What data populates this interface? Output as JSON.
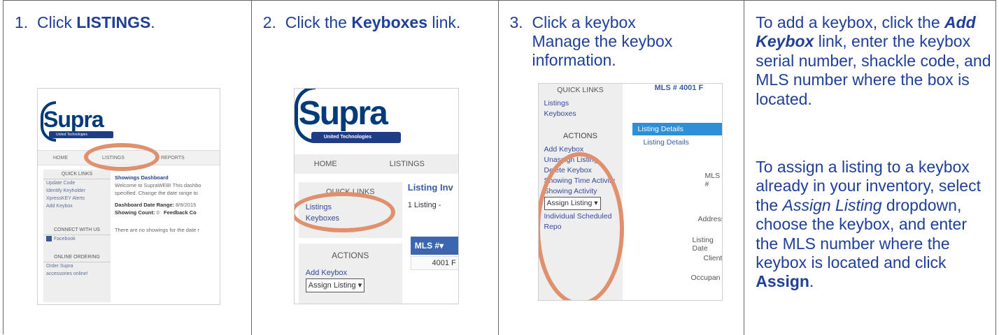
{
  "col1": {
    "num": "1.",
    "text_pre": "Click ",
    "bold": "LISTINGS",
    "text_post": "."
  },
  "col2": {
    "num": "2.",
    "text_pre": "Click the ",
    "bold": "Keyboxes",
    "text_post": " link."
  },
  "col3": {
    "num": "3.",
    "line1": "Click a keybox",
    "line2": "Manage the keybox",
    "line3": "information."
  },
  "col4": {
    "p1_pre": "To add a keybox, click the ",
    "p1_bold": "Add Keybox",
    "p1_post": " link, enter the keybox serial number, shackle code, and MLS number where the box is located.",
    "p2_pre": "To assign a listing to a keybox already in your inventory, select the ",
    "p2_ital": "Assign Listing",
    "p2_mid": " dropdown, choose the keybox, and enter the MLS number where the keybox is located and click ",
    "p2_bold": "Assign",
    "p2_post": "."
  },
  "shot1": {
    "logo": "Supra",
    "logo_tag": "United Technologies",
    "nav": [
      "HOME",
      "LISTINGS",
      "REPORTS"
    ],
    "quick_links_title": "QUICK LINKS",
    "quick_links": [
      "Update Code",
      "Identify Keyholder",
      "XpressKEY Alerts",
      "Add Keybox"
    ],
    "connect_title": "CONNECT WITH US",
    "facebook": "Facebook",
    "online_title": "ONLINE ORDERING",
    "online_lines": [
      "Order Supra",
      "accessories online!"
    ],
    "dash_title": "Showings Dashboard",
    "dash_line1": "Welcome to SupraWEB! This dashbo",
    "dash_line2": "specified. Change the date range to",
    "range_label": "Dashboard Date Range:",
    "range_value": "8/9/2015",
    "count_label": "Showing Count:",
    "count_value": "0",
    "feedback_label": "Feedback Co",
    "no_showings": "There are no showings for the date r"
  },
  "shot2": {
    "logo": "Supra",
    "logo_tag": "United Technologies",
    "nav": [
      "HOME",
      "LISTINGS"
    ],
    "quick_links_title": "QUICK LINKS",
    "quick_links": [
      "Listings",
      "Keyboxes"
    ],
    "actions_title": "ACTIONS",
    "add_keybox": "Add Keybox",
    "assign_listing": "Assign Listing",
    "inv_title": "Listing Inv",
    "count": "1 Listing -",
    "mls_header": "MLS #",
    "mls_row": "4001 F"
  },
  "shot3": {
    "quick_links_title": "QUICK LINKS",
    "quick_links": [
      "Listings",
      "Keyboxes"
    ],
    "actions_title": "ACTIONS",
    "actions": [
      "Add Keybox",
      "Unassign Listing",
      "Delete Keybox",
      "Showing Time Activity",
      "Showing Activity"
    ],
    "assign_listing": "Assign Listing",
    "more_actions": [
      "Individual Scheduled Repo"
    ],
    "mls_title": "MLS # 4001 F",
    "details_btn": "Listing Details",
    "details_link": "Listing Details",
    "labels": [
      "MLS #",
      "Address",
      "Listing Date",
      "Client",
      "Occupan"
    ]
  }
}
